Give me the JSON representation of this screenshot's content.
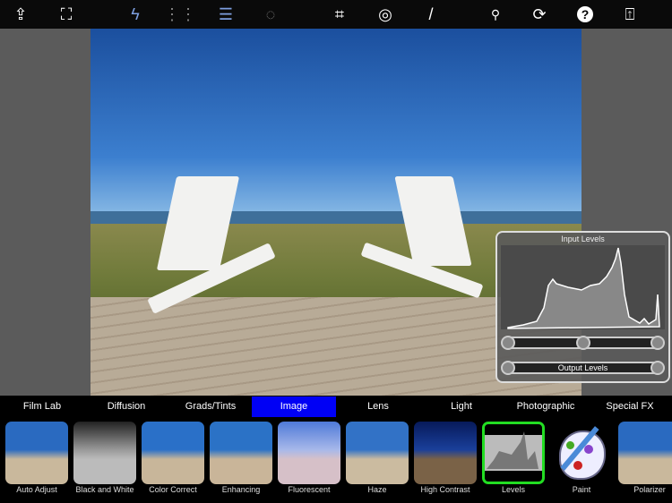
{
  "toolbar": {
    "icons": [
      "import-icon",
      "fit-screen-icon",
      "quick-effects-icon",
      "grid-icon",
      "adjust-sliders-icon",
      "selection-icon",
      "crop-icon",
      "rotate-icon",
      "brush-icon",
      "search-icon",
      "refresh-icon",
      "help-icon",
      "share-icon"
    ]
  },
  "levels_panel": {
    "title": "Input Levels",
    "output_label": "Output Levels",
    "input_knobs": [
      0,
      0.5,
      1
    ],
    "output_knobs": [
      0,
      1
    ]
  },
  "tabs": [
    {
      "label": "Film Lab"
    },
    {
      "label": "Diffusion"
    },
    {
      "label": "Grads/Tints"
    },
    {
      "label": "Image",
      "active": true
    },
    {
      "label": "Lens"
    },
    {
      "label": "Light"
    },
    {
      "label": "Photographic"
    },
    {
      "label": "Special FX"
    }
  ],
  "filters": [
    {
      "label": "Auto Adjust"
    },
    {
      "label": "Black and White"
    },
    {
      "label": "Color Correct"
    },
    {
      "label": "Enhancing"
    },
    {
      "label": "Fluorescent"
    },
    {
      "label": "Haze"
    },
    {
      "label": "High Contrast"
    },
    {
      "label": "Levels",
      "selected": true
    },
    {
      "label": "Paint"
    },
    {
      "label": "Polarizer"
    }
  ],
  "colors": {
    "active_tab": "#0000f5",
    "selected_filter": "#22dd22"
  }
}
